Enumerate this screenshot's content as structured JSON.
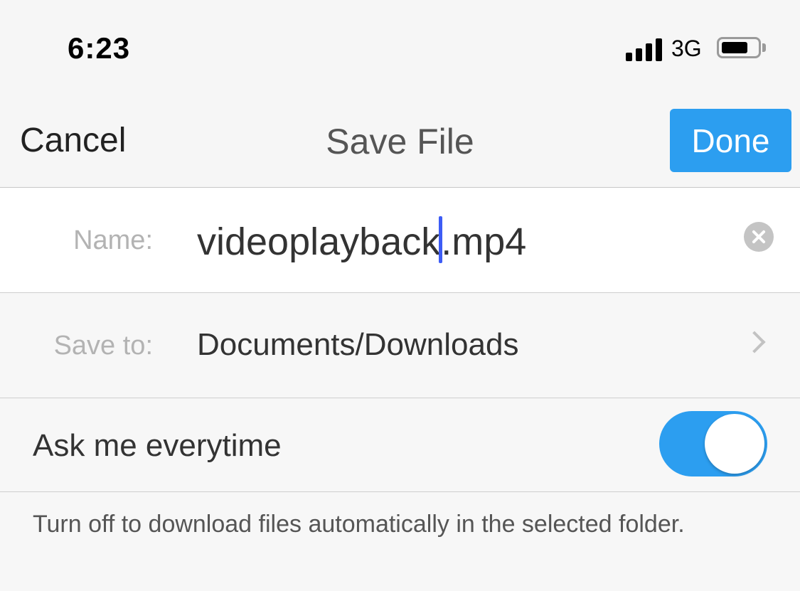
{
  "status_bar": {
    "time": "6:23",
    "network": "3G",
    "signal_bars": 4,
    "battery_level_fraction": 0.75,
    "icons": [
      "signal-icon",
      "battery-icon"
    ]
  },
  "nav": {
    "cancel_label": "Cancel",
    "title": "Save File",
    "done_label": "Done"
  },
  "form": {
    "name_label": "Name:",
    "name_value_before_caret": "videoplayback",
    "name_value_after_caret": ".mp4",
    "save_to_label": "Save to:",
    "save_to_value": "Documents/Downloads",
    "ask_label": "Ask me everytime",
    "ask_enabled": true,
    "footnote": "Turn off to download files automatically in the selected folder."
  },
  "colors": {
    "accent": "#2c9ef0",
    "caret": "#3d5cf5",
    "label_gray": "#b3b3b3",
    "text": "#333333"
  }
}
